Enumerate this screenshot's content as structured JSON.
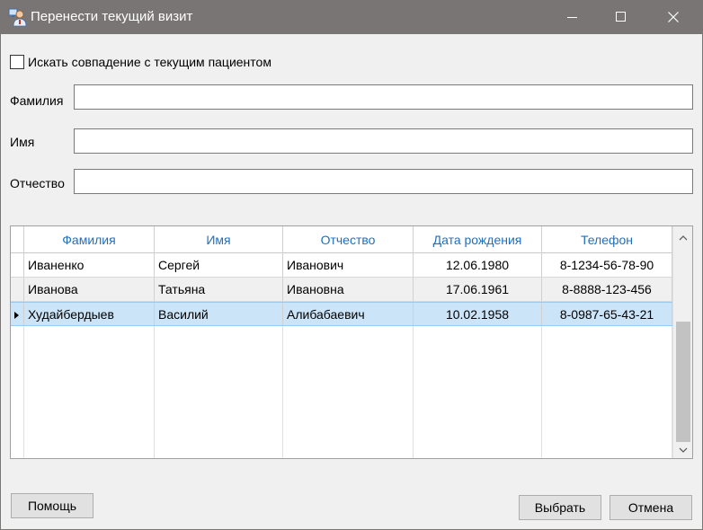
{
  "window": {
    "title": "Перенести текущий визит",
    "controls": {
      "minimize_icon": "minimize-icon",
      "maximize_icon": "maximize-icon",
      "close_icon": "close-icon"
    }
  },
  "search": {
    "match_checkbox_label": "Искать совпадение с текущим пациентом",
    "match_checked": false,
    "fields": {
      "last_name": {
        "label": "Фамилия",
        "value": ""
      },
      "first_name": {
        "label": "Имя",
        "value": ""
      },
      "middle_name": {
        "label": "Отчество",
        "value": ""
      }
    }
  },
  "grid": {
    "columns": [
      "Фамилия",
      "Имя",
      "Отчество",
      "Дата рождения",
      "Телефон"
    ],
    "rows": [
      {
        "last_name": "Иваненко",
        "first_name": "Сергей",
        "middle_name": "Иванович",
        "birth_date": "12.06.1980",
        "phone": "8-1234-56-78-90",
        "selected": false
      },
      {
        "last_name": "Иванова",
        "first_name": "Татьяна",
        "middle_name": "Ивановна",
        "birth_date": "17.06.1961",
        "phone": "8-8888-123-456",
        "selected": false
      },
      {
        "last_name": "Худайбердыев",
        "first_name": "Василий",
        "middle_name": "Алибабаевич",
        "birth_date": "10.02.1958",
        "phone": "8-0987-65-43-21",
        "selected": true
      }
    ]
  },
  "buttons": {
    "help": "Помощь",
    "select": "Выбрать",
    "cancel": "Отмена"
  },
  "colors": {
    "titlebar": "#797574",
    "header_text": "#1f6fbf",
    "selected_row": "#cce4f7"
  }
}
